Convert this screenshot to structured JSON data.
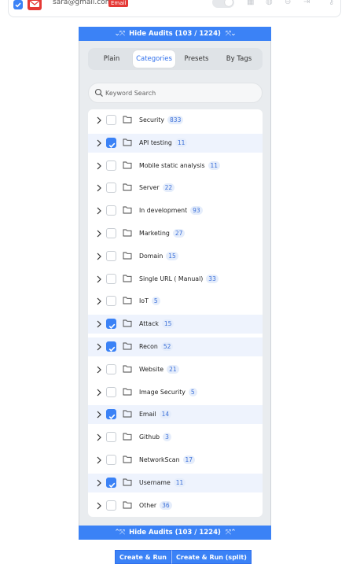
{
  "top": {
    "email": "sara@gmail.com",
    "badge": "Email"
  },
  "toggle_bar": {
    "top_label": "Hide Audits (103 / 1224)",
    "bottom_label": "Hide Audits (103 / 1224)"
  },
  "tabs": [
    {
      "label": "Plain",
      "active": false
    },
    {
      "label": "Categories",
      "active": true
    },
    {
      "label": "Presets",
      "active": false
    },
    {
      "label": "By Tags",
      "active": false
    }
  ],
  "search": {
    "placeholder": "Keyword Search",
    "value": ""
  },
  "categories": [
    {
      "name": "Security",
      "count": "833",
      "checked": false
    },
    {
      "name": "API testing",
      "count": "11",
      "checked": true
    },
    {
      "name": "Mobile static analysis",
      "count": "11",
      "checked": false
    },
    {
      "name": "Server",
      "count": "22",
      "checked": false
    },
    {
      "name": "In development",
      "count": "93",
      "checked": false
    },
    {
      "name": "Marketing",
      "count": "27",
      "checked": false
    },
    {
      "name": "Domain",
      "count": "15",
      "checked": false
    },
    {
      "name": "Single URL ( Manual)",
      "count": "33",
      "checked": false
    },
    {
      "name": "IoT",
      "count": "5",
      "checked": false
    },
    {
      "name": "Attack",
      "count": "15",
      "checked": true
    },
    {
      "name": "Recon",
      "count": "52",
      "checked": true
    },
    {
      "name": "Website",
      "count": "21",
      "checked": false
    },
    {
      "name": "Image Security",
      "count": "5",
      "checked": false
    },
    {
      "name": "Email",
      "count": "14",
      "checked": true
    },
    {
      "name": "Github",
      "count": "3",
      "checked": false
    },
    {
      "name": "NetworkScan",
      "count": "17",
      "checked": false
    },
    {
      "name": "Username",
      "count": "11",
      "checked": true
    },
    {
      "name": "Other",
      "count": "36",
      "checked": false
    }
  ],
  "actions": {
    "run_label": "Create & Run",
    "run_split_label": "Create & Run (split)"
  },
  "colors": {
    "accent": "#3b82f6",
    "selected_row": "#eef3fd",
    "badge_red": "#e53935"
  }
}
